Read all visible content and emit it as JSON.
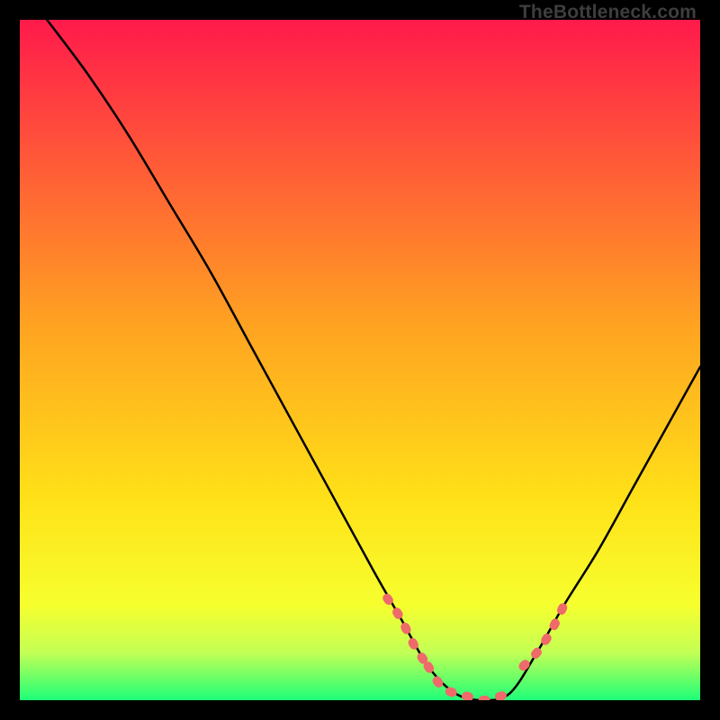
{
  "watermark": "TheBottleneck.com",
  "chart_data": {
    "type": "line",
    "title": "",
    "xlabel": "",
    "ylabel": "",
    "xlim": [
      0,
      100
    ],
    "ylim": [
      0,
      100
    ],
    "curve": {
      "name": "bottleneck-curve",
      "x": [
        4,
        10,
        16,
        22,
        28,
        34,
        40,
        46,
        52,
        56,
        60,
        64,
        68,
        72,
        76,
        80,
        85,
        90,
        95,
        100
      ],
      "y_pct": [
        100,
        92,
        83,
        73,
        63,
        52,
        41,
        30,
        19,
        12,
        5,
        1,
        0,
        1,
        7,
        14,
        22,
        31,
        40,
        49
      ]
    },
    "highlight_segments": [
      {
        "x": [
          54,
          56,
          58,
          60
        ],
        "y_pct": [
          15,
          12,
          8,
          5
        ]
      },
      {
        "x": [
          60,
          62,
          64,
          66,
          68,
          70,
          72
        ],
        "y_pct": [
          5,
          2,
          1,
          0.5,
          0,
          0.4,
          1
        ]
      },
      {
        "x": [
          74,
          76,
          78,
          80
        ],
        "y_pct": [
          5,
          7,
          10,
          14
        ]
      }
    ],
    "gradient_stops": [
      {
        "offset": 0.0,
        "color": "#ff1a4b"
      },
      {
        "offset": 0.45,
        "color": "#ffa321"
      },
      {
        "offset": 0.7,
        "color": "#ffe018"
      },
      {
        "offset": 0.86,
        "color": "#f6ff2e"
      },
      {
        "offset": 0.93,
        "color": "#c3ff55"
      },
      {
        "offset": 1.0,
        "color": "#1eff78"
      }
    ]
  }
}
